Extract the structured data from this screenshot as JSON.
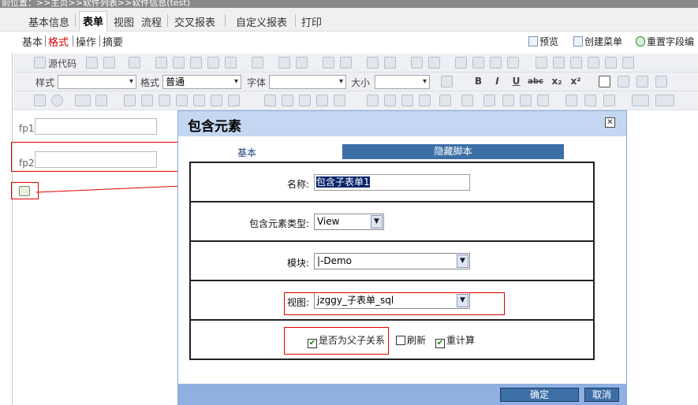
{
  "breadcrumb": "前位置：>>主页>>软件列表>>软件信息(test)",
  "tabs": [
    {
      "label": "基本信息"
    },
    {
      "label": "表单"
    },
    {
      "label": "视图"
    },
    {
      "label": "流程"
    },
    {
      "label": "交叉报表"
    },
    {
      "label": "自定义报表"
    },
    {
      "label": "打印"
    }
  ],
  "subnav": [
    {
      "label": "基本"
    },
    {
      "label": "格式"
    },
    {
      "label": "操作"
    },
    {
      "label": "摘要"
    }
  ],
  "actions": {
    "preview": "预览",
    "create_menu": "创建菜单",
    "reset_fields": "重置字段编"
  },
  "toolbar": {
    "source": "源代码",
    "style_label": "样式",
    "format_label": "格式",
    "format_value": "普通",
    "font_label": "字体",
    "size_label": "大小",
    "bold": "B",
    "italic": "I",
    "underline": "U",
    "strike": "abc",
    "subscript": "x₂",
    "superscript": "x²"
  },
  "form": {
    "fp1": "fp1:",
    "fp2": "fp2:"
  },
  "dialog": {
    "title": "包含元素",
    "tab_basic": "基本",
    "tab_hidden": "隐藏脚本",
    "name_label": "名称:",
    "name_value": "包含子表单1",
    "type_label": "包含元素类型:",
    "type_value": "View",
    "module_label": "模块:",
    "module_value": "|-Demo",
    "view_label": "视图:",
    "view_value": "jzggy_子表单_sql",
    "opt_parent": "是否为父子关系",
    "opt_refresh": "刷新",
    "opt_recalc": "重计算",
    "ok": "确定",
    "cancel": "取消"
  },
  "colors": {
    "accent": "#3d6fa7",
    "title_bg": "#c4d7f2",
    "highlight": "#e00000"
  }
}
